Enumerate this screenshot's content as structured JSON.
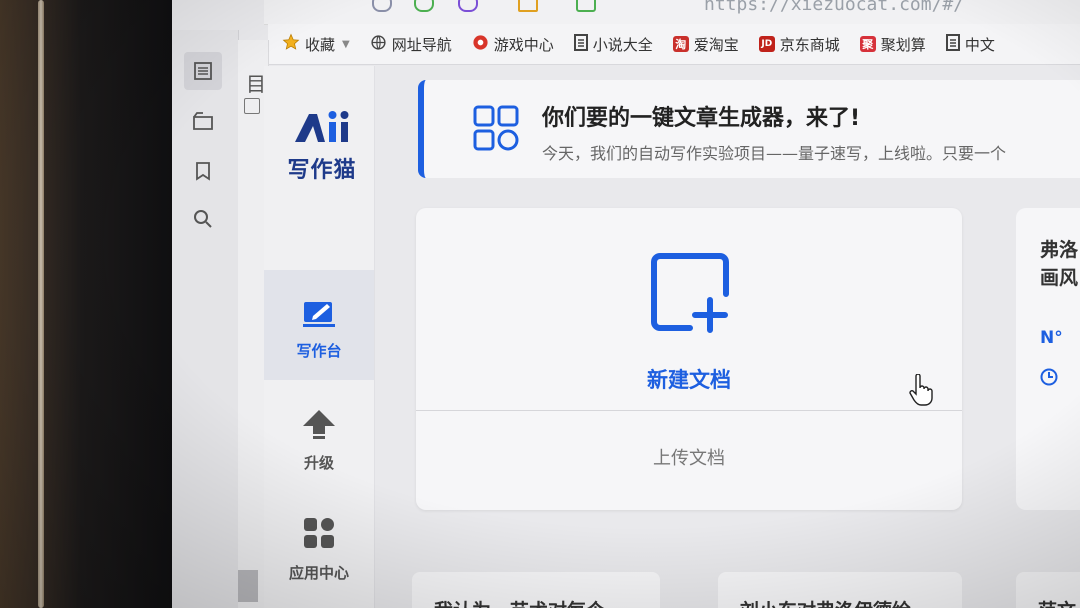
{
  "browser": {
    "url": "https://xiezuocat.com/#/"
  },
  "bookmarks": [
    {
      "label": "收藏",
      "icon": "star-icon"
    },
    {
      "label": "网址导航",
      "icon": "globe-icon"
    },
    {
      "label": "游戏中心",
      "icon": "game-icon"
    },
    {
      "label": "小说大全",
      "icon": "doc-icon"
    },
    {
      "label": "爱淘宝",
      "icon": "taobao-icon",
      "icon_text": "淘"
    },
    {
      "label": "京东商城",
      "icon": "jd-icon",
      "icon_text": "JD"
    },
    {
      "label": "聚划算",
      "icon": "juhuasuan-icon",
      "icon_text": "聚"
    },
    {
      "label": "中文",
      "icon": "doc-icon"
    }
  ],
  "side_rail": {
    "partial_text": "目"
  },
  "app": {
    "logo_text": "写作猫",
    "nav": [
      {
        "label": "写作台",
        "icon": "edit-icon"
      },
      {
        "label": "升级",
        "icon": "upgrade-arrow-icon"
      },
      {
        "label": "应用中心",
        "icon": "apps-icon"
      }
    ]
  },
  "banner": {
    "title": "你们要的一键文章生成器，来了!",
    "subtitle": "今天，我们的自动写作实验项目——量子速写，上线啦。只要一个"
  },
  "card": {
    "new_doc_label": "新建文档",
    "upload_label": "上传文档"
  },
  "right_card": {
    "title_line1": "弗洛",
    "title_line2": "画风",
    "meta1": "N°"
  },
  "bottom_cards": [
    {
      "text": "我认为，艺术对每个"
    },
    {
      "text": "刘小东对弗洛伊德绘"
    },
    {
      "text": "范文"
    }
  ],
  "colors": {
    "accent": "#1d5fe0",
    "brand_dark": "#1e3a8a"
  }
}
